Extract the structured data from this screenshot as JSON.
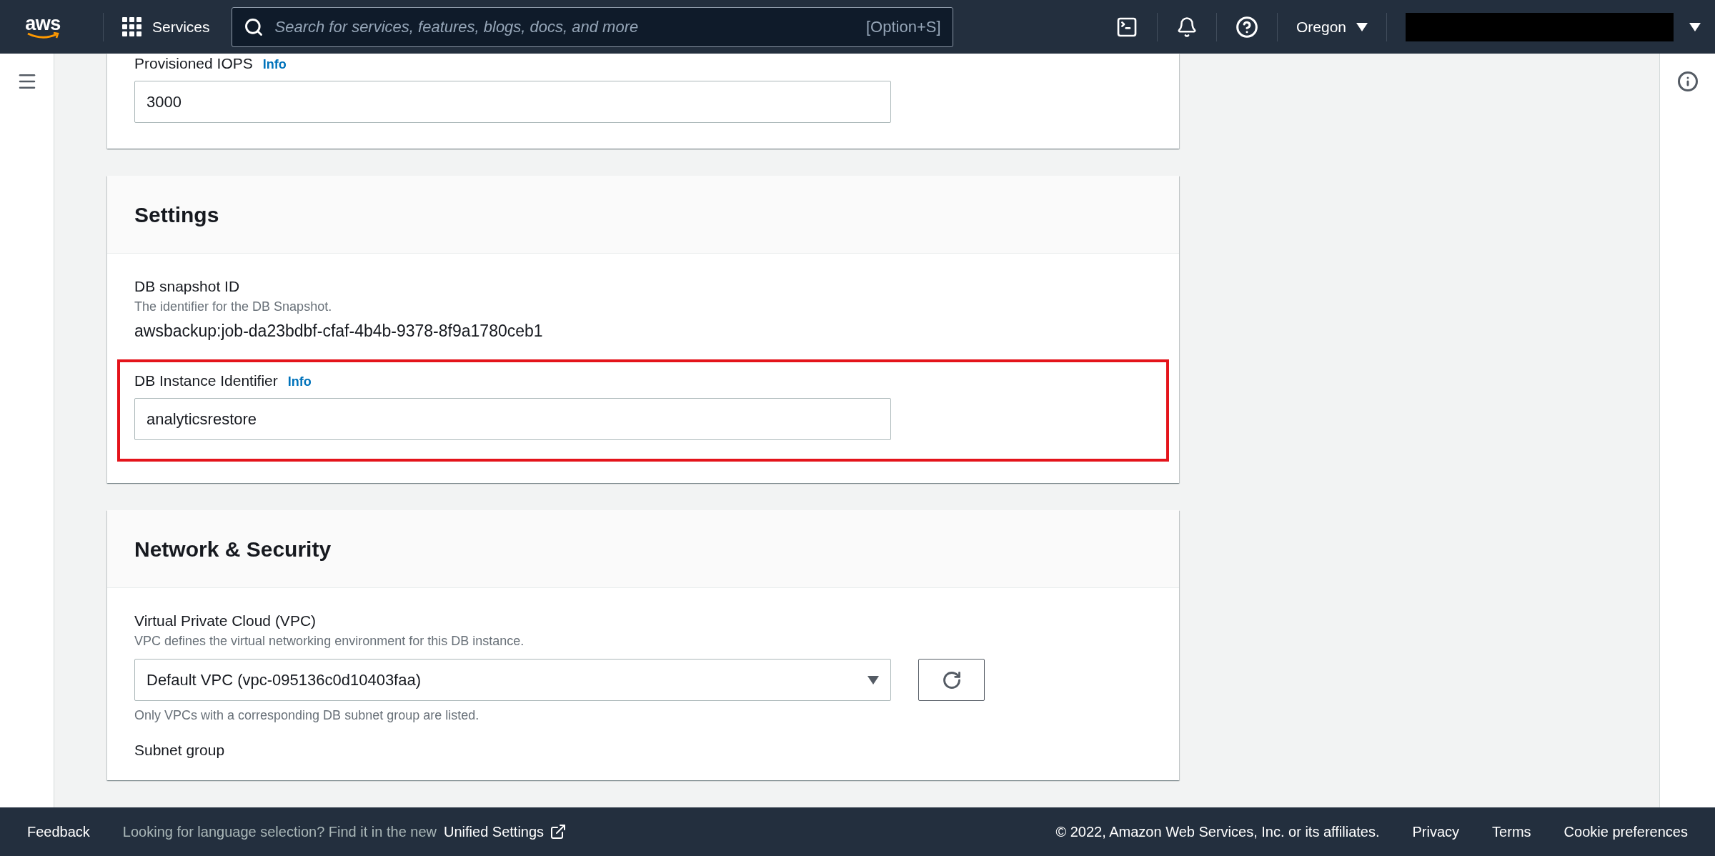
{
  "top_nav": {
    "logo": "aws",
    "services": "Services",
    "search": {
      "placeholder": "Search for services, features, blogs, docs, and more",
      "shortcut": "[Option+S]"
    },
    "region": "Oregon"
  },
  "sections": [
    {
      "kind": "plain",
      "fields": [
        {
          "kind": "input",
          "label": "Provisioned IOPS",
          "info": "Info",
          "value": "3000",
          "highlighted": false
        }
      ]
    },
    {
      "kind": "titled",
      "title": "Settings",
      "fields": [
        {
          "kind": "readonly",
          "label": "DB snapshot ID",
          "description": "The identifier for the DB Snapshot.",
          "value": "awsbackup:job-da23bdbf-cfaf-4b4b-9378-8f9a1780ceb1"
        },
        {
          "kind": "input",
          "label": "DB Instance Identifier",
          "info": "Info",
          "value": "analyticsrestore",
          "highlighted": true
        }
      ]
    },
    {
      "kind": "titled",
      "title": "Network & Security",
      "fields": [
        {
          "kind": "select",
          "label": "Virtual Private Cloud (VPC)",
          "description": "VPC defines the virtual networking environment for this DB instance.",
          "value": "Default VPC (vpc-095136c0d10403faa)",
          "hint": "Only VPCs with a corresponding DB subnet group are listed."
        },
        {
          "kind": "heading",
          "label": "Subnet group"
        }
      ]
    }
  ],
  "footer": {
    "feedback": "Feedback",
    "language_note": "Looking for language selection? Find it in the new",
    "settings_link": "Unified Settings",
    "copyright": "© 2022, Amazon Web Services, Inc. or its affiliates.",
    "links": [
      "Privacy",
      "Terms",
      "Cookie preferences"
    ]
  }
}
